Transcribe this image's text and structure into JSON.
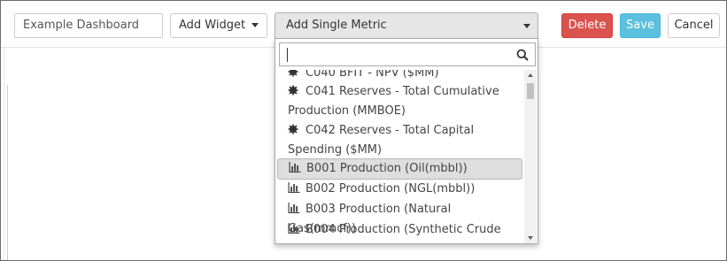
{
  "toolbar": {
    "dashboard_name": "Example Dashboard",
    "add_widget_label": "Add Widget",
    "add_metric_label": "Add Single Metric",
    "delete_label": "Delete",
    "save_label": "Save",
    "cancel_label": "Cancel"
  },
  "colors": {
    "delete": "#d9534f",
    "save": "#5bc0de",
    "select_bg": "#e6e6e6",
    "highlight_bg": "#dedede"
  },
  "dropdown": {
    "search_value": "",
    "search_icon": "search-icon",
    "results": [
      {
        "label": "C040 BFIT - NPV ($MM)",
        "icon": "gear-icon"
      },
      {
        "label": "C041 Reserves - Total Cumulative",
        "icon": "gear-icon"
      },
      {
        "label": "Production (MMBOE)",
        "icon": ""
      },
      {
        "label": "C042 Reserves - Total Capital",
        "icon": "gear-icon"
      },
      {
        "label": "Spending ($MM)",
        "icon": ""
      },
      {
        "label": "B001 Production (Oil(mbbl))",
        "icon": "bar-chart-icon",
        "highlighted": true
      },
      {
        "label": "B002 Production (NGL(mbbl))",
        "icon": "bar-chart-icon"
      },
      {
        "label": "B003 Production (Natural Gas(mmcf))",
        "icon": "bar-chart-icon"
      },
      {
        "label": "B004 Production (Synthetic Crude",
        "icon": "bar-chart-icon"
      }
    ]
  }
}
